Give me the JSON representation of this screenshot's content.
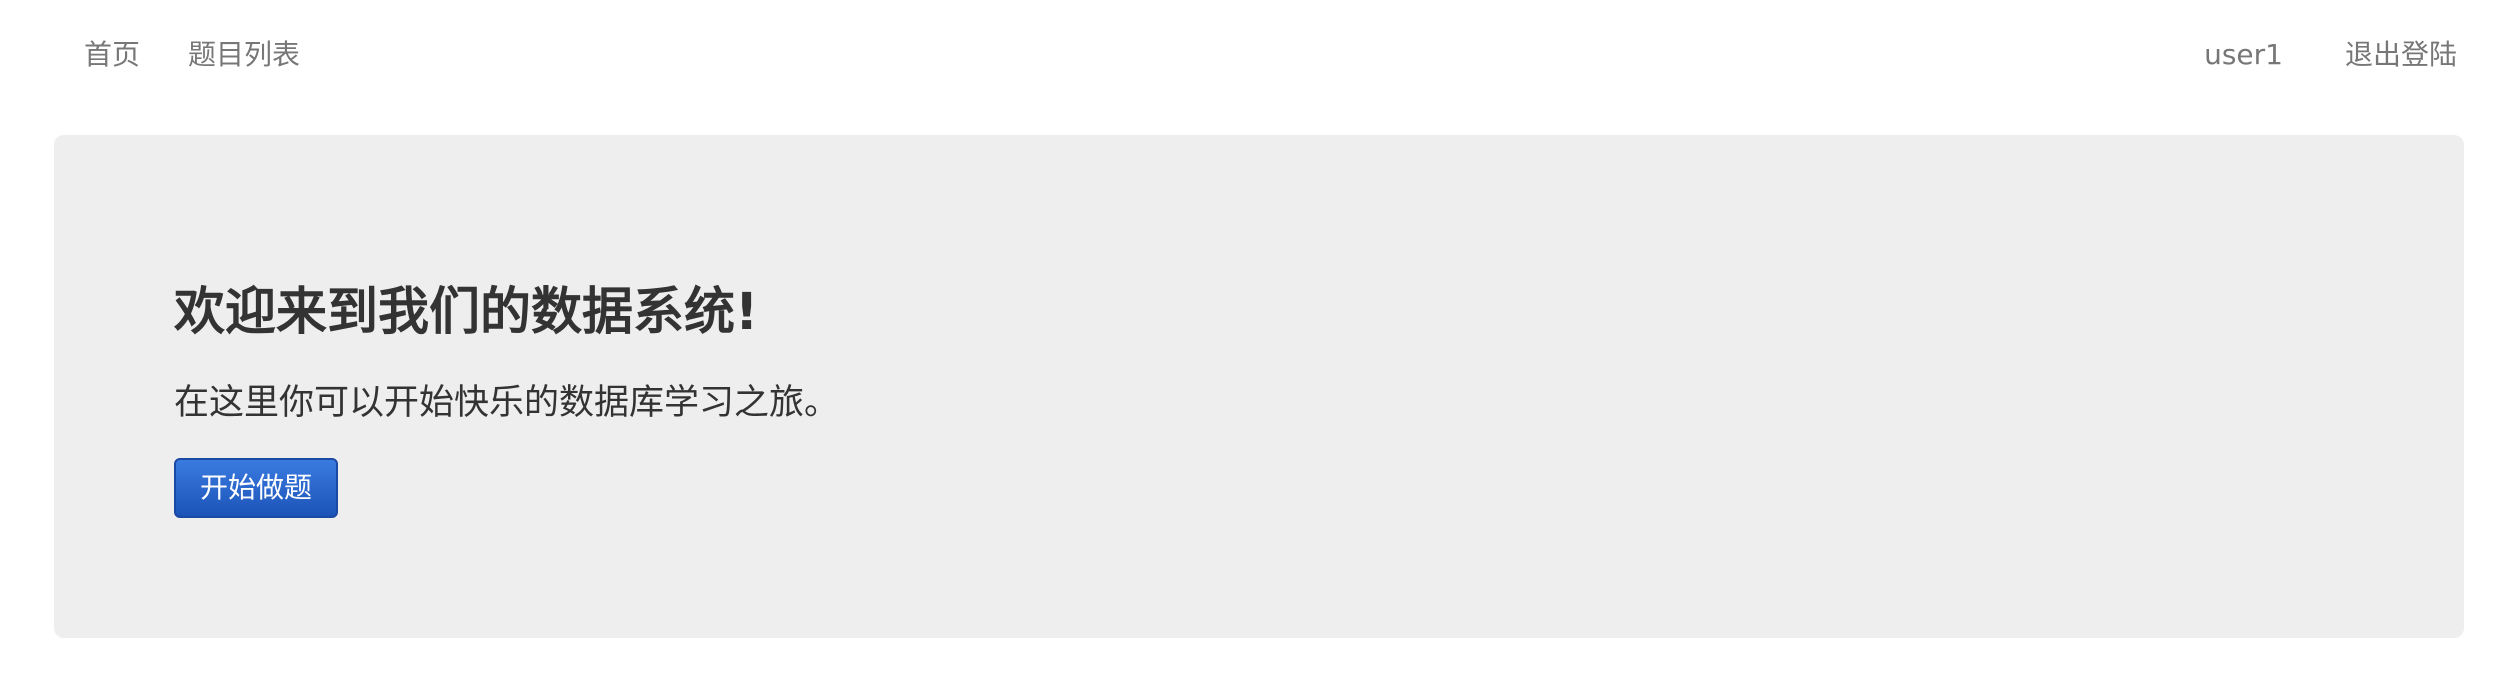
{
  "nav": {
    "left": [
      {
        "label": "首页"
      },
      {
        "label": "题目列表"
      }
    ],
    "right": [
      {
        "label": "user1"
      },
      {
        "label": "退出登陆"
      }
    ]
  },
  "jumbotron": {
    "title": "欢迎来到我们的数据系统!",
    "subtitle": "在这里你可以开始快乐的数据库学习之旅。",
    "button_label": "开始做题"
  },
  "colors": {
    "button": "#1c54b8",
    "panel": "#eeeeee",
    "nav_text": "#777777"
  }
}
